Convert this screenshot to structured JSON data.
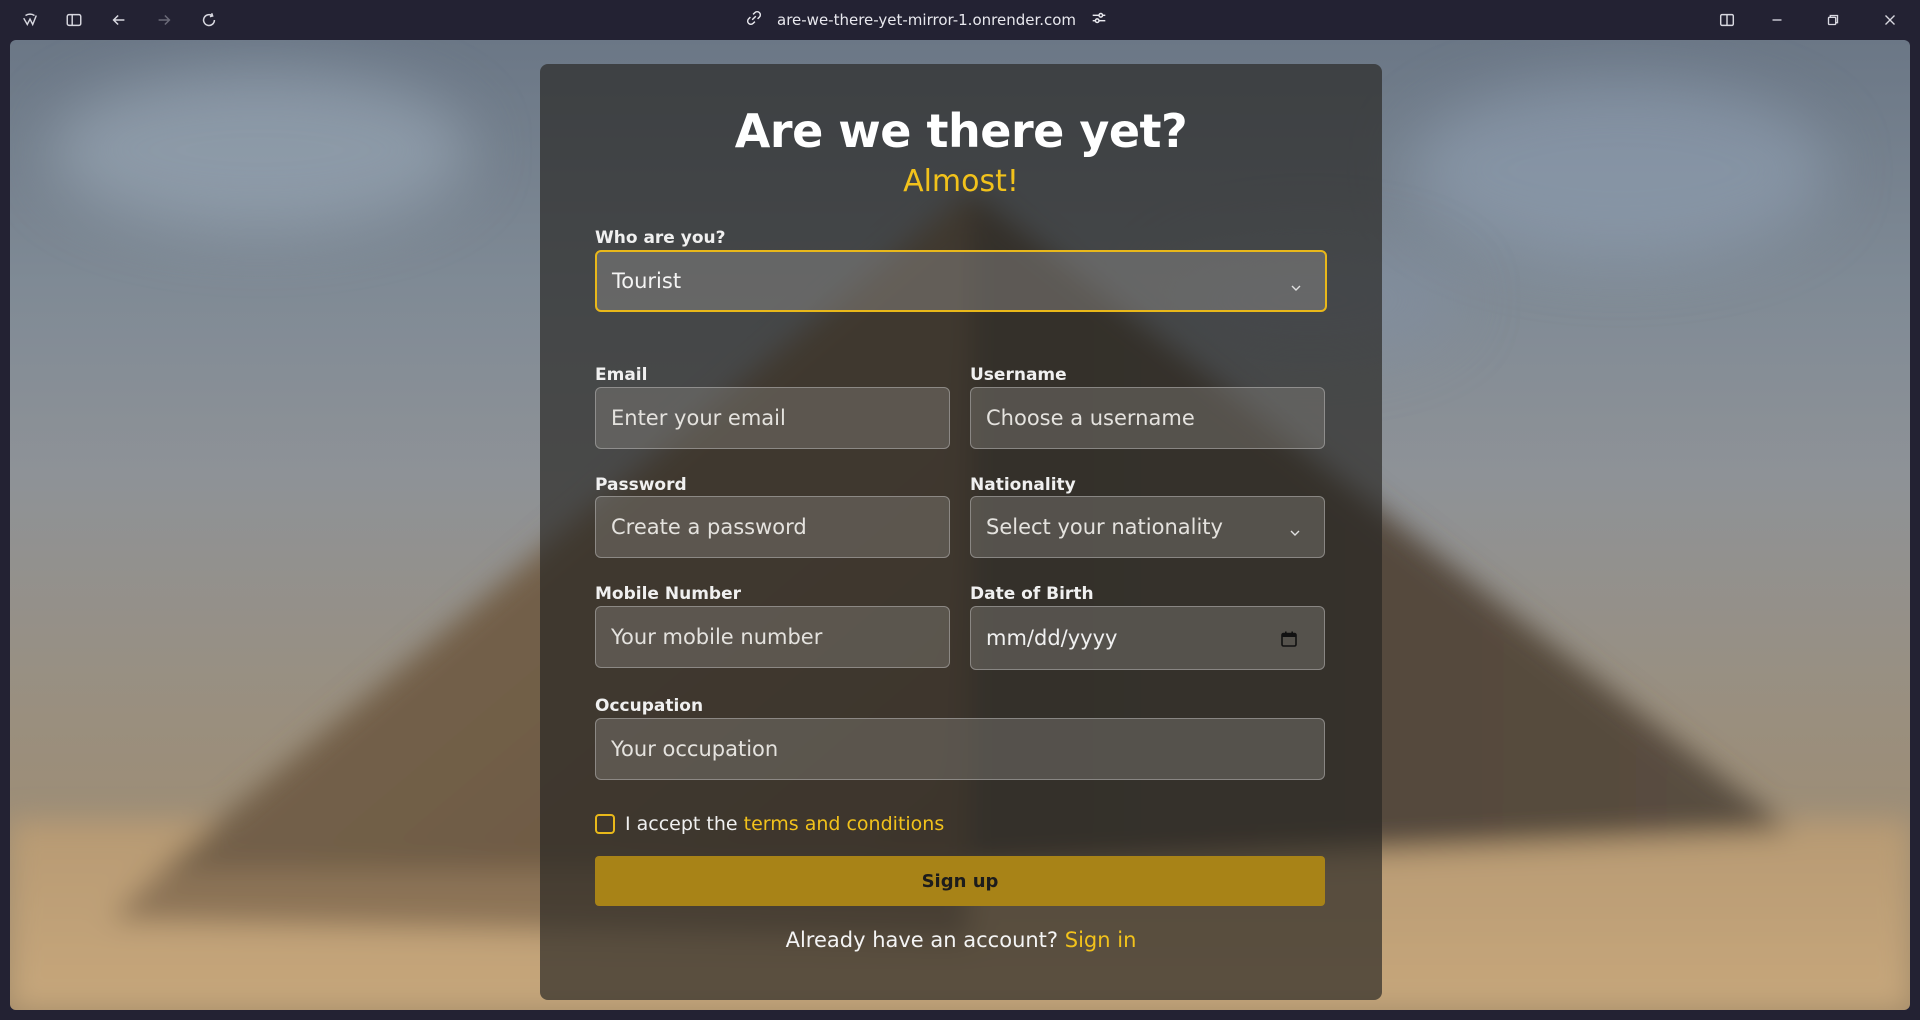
{
  "browser": {
    "url": "are-we-there-yet-mirror-1.onrender.com",
    "icons": [
      "app-logo-icon",
      "sidebar-toggle-icon",
      "back-icon",
      "forward-icon",
      "reload-icon",
      "link-icon",
      "site-settings-icon",
      "split-view-icon",
      "minimize-icon",
      "restore-icon",
      "close-icon"
    ]
  },
  "form": {
    "title": "Are we there yet?",
    "subtitle": "Almost!",
    "role_label": "Who are you?",
    "role_value": "Tourist",
    "email_label": "Email",
    "email_placeholder": "Enter your email",
    "username_label": "Username",
    "username_placeholder": "Choose a username",
    "password_label": "Password",
    "password_placeholder": "Create a password",
    "nationality_label": "Nationality",
    "nationality_placeholder": "Select your nationality",
    "mobile_label": "Mobile Number",
    "mobile_placeholder": "Your mobile number",
    "dob_label": "Date of Birth",
    "dob_placeholder": "mm/dd/yyyy",
    "occupation_label": "Occupation",
    "occupation_placeholder": "Your occupation",
    "terms_prefix": "I accept the ",
    "terms_link": "terms and conditions",
    "terms_checked": false,
    "signup_label": "Sign up",
    "already_text": "Already have an account? ",
    "signin_link": "Sign in"
  },
  "colors": {
    "accent": "#f2c21b",
    "button": "#a88317",
    "chrome": "#232233"
  }
}
